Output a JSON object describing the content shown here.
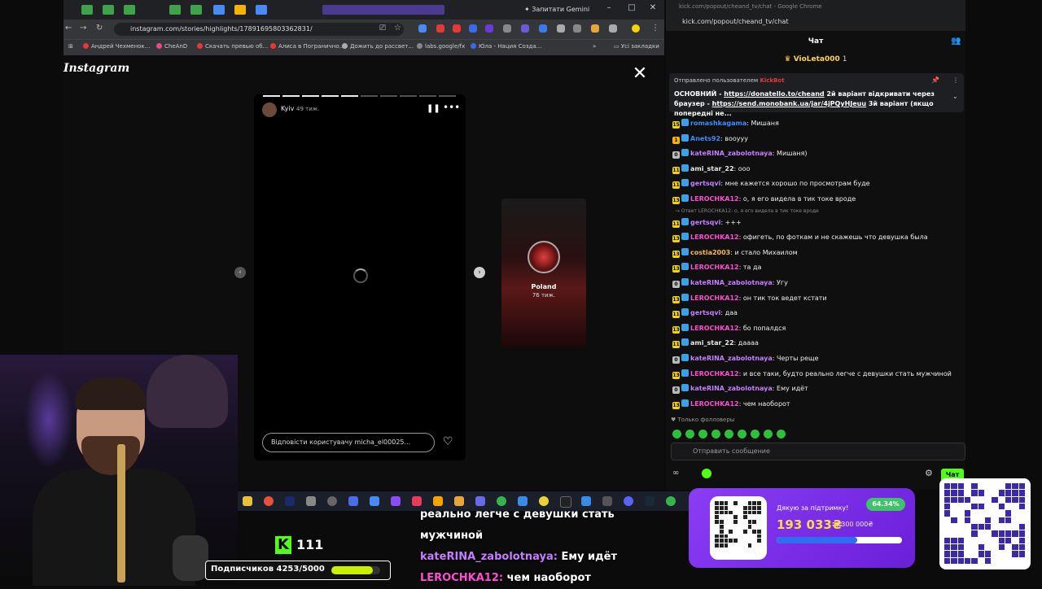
{
  "browser": {
    "tab_label": "Запитати Gemini",
    "url": "instagram.com/stories/highlights/17891695803362831/",
    "bookmarks": [
      "Андрей Чехменок...",
      "CheAnD",
      "Скачать превью об...",
      "Алиса в Погранично...",
      "Дожить до рассвет...",
      "labs.google/fx",
      "Юла - Нация Созда..."
    ],
    "other_bookmarks": "Усі закладки"
  },
  "instagram": {
    "logo": "Instagram",
    "story_location": "Kyiv",
    "story_age": "49 тиж.",
    "next_story_label": "Poland",
    "next_story_age": "76 тиж.",
    "reply_placeholder": "Відповісти користувачу micha_el00025...",
    "progress_segments": 10,
    "progress_active": 5
  },
  "chat": {
    "window_title": "kick.com/popout/cheand_tv/chat - Google Chrome",
    "url": "kick.com/popout/cheand_tv/chat",
    "header": "Чат",
    "gift_user": "VioLeta000",
    "gift_count": "1",
    "pinned_by_prefix": "Отправлено пользователем",
    "pinned_by_user": "KickBot",
    "pinned_text_1": "ОСНОВНИЙ - ",
    "pinned_link_1": "https://donatello.to/cheand",
    "pinned_text_2": " 2й варіант відкривати через браузер - ",
    "pinned_link_2": "https://send.monobank.ua/jar/4jPQyHJeuu",
    "pinned_text_3": " 3й варіант (якщо попередні не...",
    "reply_note": "Ответ LEROCHKA12: о, я его видела в тик токе вроде",
    "messages": [
      {
        "badge": "15",
        "user": "romashkagama",
        "text": "Мишаня",
        "color": "#3d8bff"
      },
      {
        "badge": "1",
        "user": "Anets92",
        "text": "вооууу",
        "color": "#3d8bff"
      },
      {
        "badge": "0",
        "user": "kateRINA_zabolotnaya",
        "text": "Мишаня)",
        "color": "#c77dff"
      },
      {
        "badge": "11",
        "user": "ami_star_22",
        "text": "ооо",
        "color": "#e8e8e8"
      },
      {
        "badge": "11",
        "user": "gertsqvi",
        "text": "мне кажется хорошо по просмотрам буде",
        "color": "#c77dff"
      },
      {
        "badge": "13",
        "user": "LEROCHKA12",
        "text": "о, я его видела в тик токе вроде",
        "color": "#ff4dd2"
      },
      {
        "badge": "11",
        "user": "gertsqvi",
        "text": "+++",
        "color": "#c77dff"
      },
      {
        "badge": "13",
        "user": "LEROCHKA12",
        "text": "офигеть, по фоткам и не скажешь что девушка была",
        "color": "#ff4dd2"
      },
      {
        "badge": "13",
        "user": "costia2003",
        "text": "и стало Михаилом",
        "color": "#ffb84d"
      },
      {
        "badge": "13",
        "user": "LEROCHKA12",
        "text": "та да",
        "color": "#ff4dd2"
      },
      {
        "badge": "0",
        "user": "kateRINA_zabolotnaya",
        "text": "Угу",
        "color": "#c77dff"
      },
      {
        "badge": "13",
        "user": "LEROCHKA12",
        "text": "он тик ток ведет кстати",
        "color": "#ff4dd2"
      },
      {
        "badge": "11",
        "user": "gertsqvi",
        "text": "даа",
        "color": "#c77dff"
      },
      {
        "badge": "13",
        "user": "LEROCHKA12",
        "text": "бо попалдся",
        "color": "#ff4dd2"
      },
      {
        "badge": "11",
        "user": "ami_star_22",
        "text": "даааа",
        "color": "#e8e8e8"
      },
      {
        "badge": "0",
        "user": "kateRINA_zabolotnaya",
        "text": "Черты реще",
        "color": "#c77dff"
      },
      {
        "badge": "13",
        "user": "LEROCHKA12",
        "text": "и все таки, будто реально легче с девушки стать мужчиной",
        "color": "#ff4dd2"
      },
      {
        "badge": "0",
        "user": "kateRINA_zabolotnaya",
        "text": "Ему идёт",
        "color": "#c77dff"
      },
      {
        "badge": "13",
        "user": "LEROCHKA12",
        "text": "чем наоборот",
        "color": "#ff4dd2"
      }
    ],
    "followers_only": "Только фолловеры",
    "input_placeholder": "Отправить сообщение",
    "send_label": "Чат"
  },
  "overlay": {
    "kick_count": "111",
    "subs_label": "Подписчиков 4253/5000",
    "subs_progress": 0.85,
    "chat_lines": [
      {
        "user": "",
        "text": "реально легче с девушки стать"
      },
      {
        "user": "",
        "text": "мужчиной"
      },
      {
        "user": "kateRINA_zabolotnaya:",
        "text": "Ему идёт",
        "cls": "u1"
      },
      {
        "user": "LEROCHKA12:",
        "text": "чем наоборот",
        "cls": "u2"
      }
    ],
    "donate_title": "Дякую за підтримку!",
    "donate_percent": "64.34%",
    "donate_amount": "193 033₴",
    "donate_goal": "/ 300 000₴",
    "donate_progress": 0.6434
  },
  "colors": {
    "kick_green": "#53fc18",
    "donate_purple": "#7a2ee8"
  }
}
